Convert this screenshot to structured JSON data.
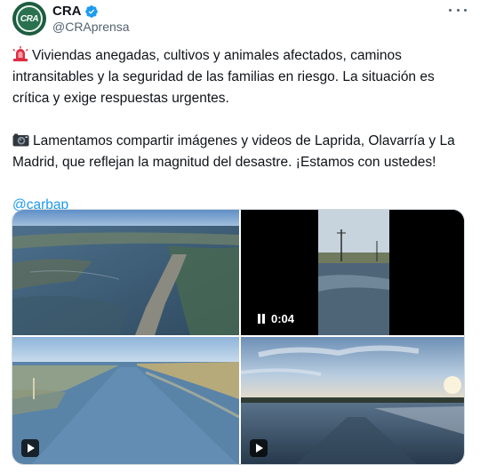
{
  "account": {
    "display_name": "CRA",
    "handle": "@CRAprensa",
    "avatar_text": "CRA",
    "verified": true
  },
  "tweet": {
    "paragraph1": "Viviendas anegadas, cultivos y animales afectados, caminos intransitables y la seguridad de las familias en riesgo. La situación es crítica y exige respuestas urgentes.",
    "paragraph2": "Lamentamos compartir imágenes y videos de Laprida, Olavarría y La Madrid, que reflejan la magnitud del desastre. ¡Estamos con ustedes!",
    "mention": "@carbap",
    "icons": [
      "siren-icon",
      "camera-icon"
    ]
  },
  "media": {
    "video_duration": "0:04",
    "items": [
      "aerial-flooded-road-photo",
      "flooded-field-video",
      "flooded-road-video",
      "flooded-field-sunset-video"
    ]
  },
  "colors": {
    "accent": "#1d9bf0",
    "text": "#0f1419",
    "secondary": "#536471",
    "avatar_bg": "#1d5c3f"
  }
}
